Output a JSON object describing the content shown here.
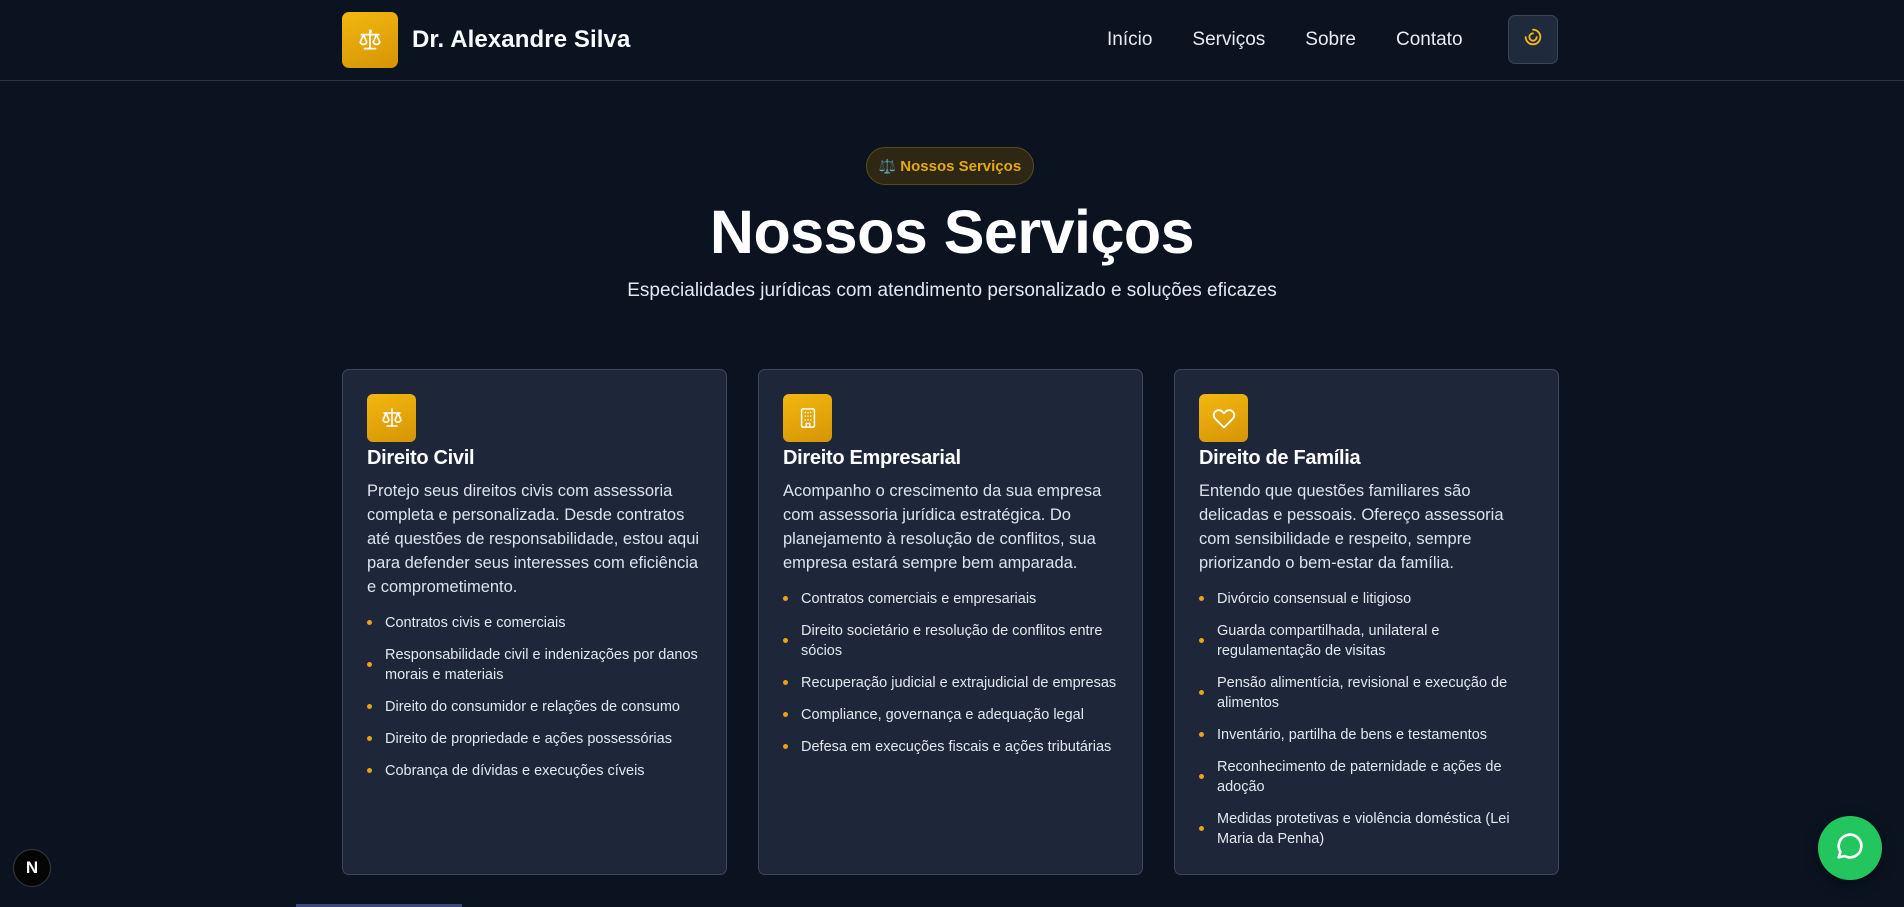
{
  "brand": {
    "name": "Dr. Alexandre Silva",
    "logo_icon": "scales-icon"
  },
  "nav": {
    "items": [
      {
        "label": "Início"
      },
      {
        "label": "Serviços"
      },
      {
        "label": "Sobre"
      },
      {
        "label": "Contato"
      }
    ],
    "theme_toggle_icon": "sun-icon"
  },
  "hero": {
    "badge_icon": "⚖️",
    "badge_label": "Nossos Serviços",
    "title": "Nossos Serviços",
    "subtitle": "Especialidades jurídicas com atendimento personalizado e soluções eficazes"
  },
  "services": [
    {
      "icon": "scales-icon",
      "title": "Direito Civil",
      "description": "Protejo seus direitos civis com assessoria completa e personalizada. Desde contratos até questões de responsabilidade, estou aqui para defender seus interesses com eficiência e comprometimento.",
      "items": [
        "Contratos civis e comerciais",
        "Responsabilidade civil e indenizações por danos morais e materiais",
        "Direito do consumidor e relações de consumo",
        "Direito de propriedade e ações possessórias",
        "Cobrança de dívidas e execuções cíveis"
      ]
    },
    {
      "icon": "building-icon",
      "title": "Direito Empresarial",
      "description": "Acompanho o crescimento da sua empresa com assessoria jurídica estratégica. Do planejamento à resolução de conflitos, sua empresa estará sempre bem amparada.",
      "items": [
        "Contratos comerciais e empresariais",
        "Direito societário e resolução de conflitos entre sócios",
        "Recuperação judicial e extrajudicial de empresas",
        "Compliance, governança e adequação legal",
        "Defesa em execuções fiscais e ações tributárias"
      ]
    },
    {
      "icon": "heart-icon",
      "title": "Direito de Família",
      "description": "Entendo que questões familiares são delicadas e pessoais. Ofereço assessoria com sensibilidade e respeito, sempre priorizando o bem-estar da família.",
      "items": [
        "Divórcio consensual e litigioso",
        "Guarda compartilhada, unilateral e regulamentação de visitas",
        "Pensão alimentícia, revisional e execução de alimentos",
        "Inventário, partilha de bens e testamentos",
        "Reconhecimento de paternidade e ações de adoção",
        "Medidas protetivas e violência doméstica (Lei Maria da Penha)"
      ]
    }
  ],
  "floating": {
    "next_badge": "N",
    "whatsapp_icon": "whatsapp-icon"
  },
  "colors": {
    "accent": "#e9a60c",
    "background": "#0b1321",
    "card": "#1d2739",
    "whatsapp": "#23c55e"
  }
}
